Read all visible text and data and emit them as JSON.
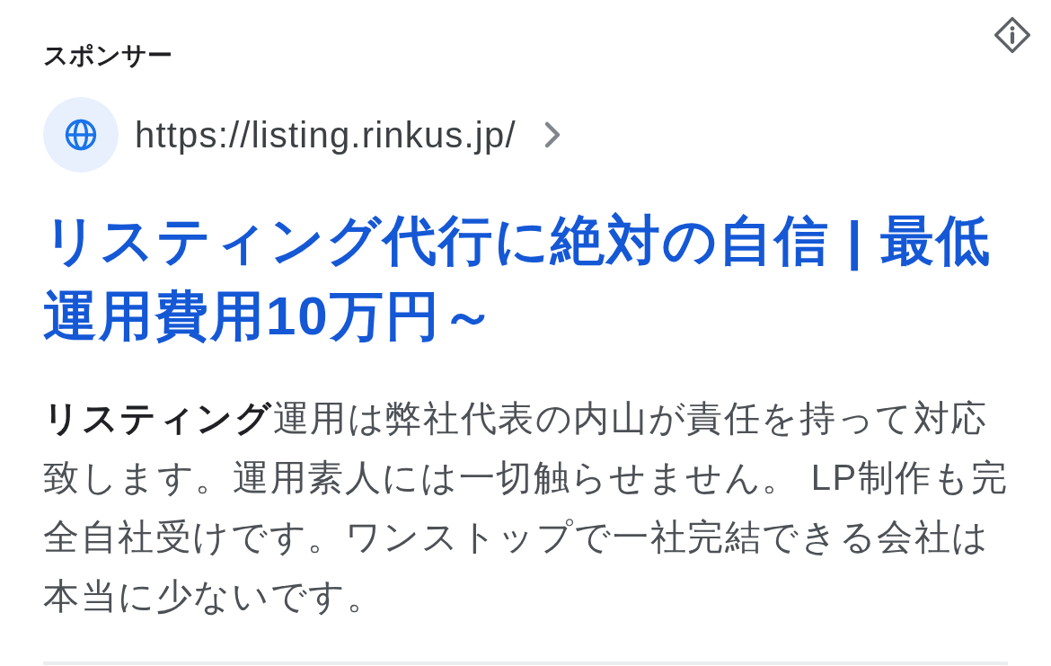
{
  "label": "スポンサー",
  "site": {
    "url": "https://listing.rinkus.jp/"
  },
  "title": "リスティング代行に絶対の自信 | 最低運用費用10万円～",
  "description": "**リスティング**運用は弊社代表の内山が責任を持って対応致します。運用素人には一切触らせません。 LP制作も完全自社受けです。ワンストップで一社完結できる会社は本当に少ないです。"
}
